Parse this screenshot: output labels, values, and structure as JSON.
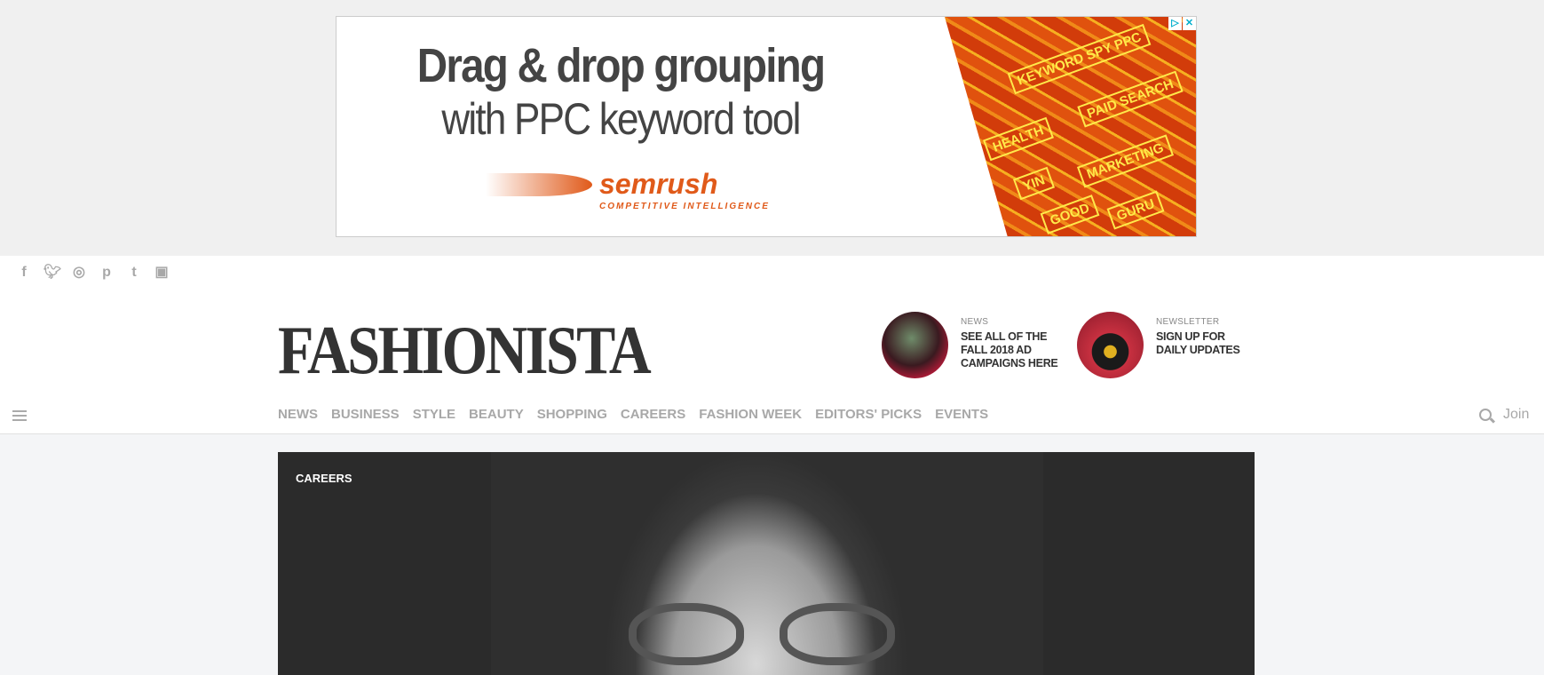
{
  "ad": {
    "headline": "Drag & drop grouping",
    "subline": "with PPC keyword tool",
    "brand": "semrush",
    "tagline": "COMPETITIVE INTELLIGENCE",
    "image_words": [
      "KEYWORD SPY PPC",
      "PAID SEARCH",
      "HEALTH",
      "MARKETING",
      "YIN",
      "GOOD",
      "GURU"
    ],
    "adchoices_icon": "adchoices-icon",
    "close_icon": "close-icon"
  },
  "social": [
    "facebook-icon",
    "twitter-icon",
    "instagram-icon",
    "pinterest-icon",
    "tumblr-icon",
    "flipboard-icon"
  ],
  "logo": "FASHIONISTA",
  "promos": [
    {
      "kicker": "NEWS",
      "title": "SEE ALL OF THE FALL 2018 AD CAMPAIGNS HERE"
    },
    {
      "kicker": "NEWSLETTER",
      "title": "SIGN UP FOR DAILY UPDATES"
    }
  ],
  "nav": [
    "NEWS",
    "BUSINESS",
    "STYLE",
    "BEAUTY",
    "SHOPPING",
    "CAREERS",
    "FASHION WEEK",
    "EDITORS' PICKS",
    "EVENTS"
  ],
  "join": "Join",
  "hero": {
    "category": "CAREERS"
  }
}
